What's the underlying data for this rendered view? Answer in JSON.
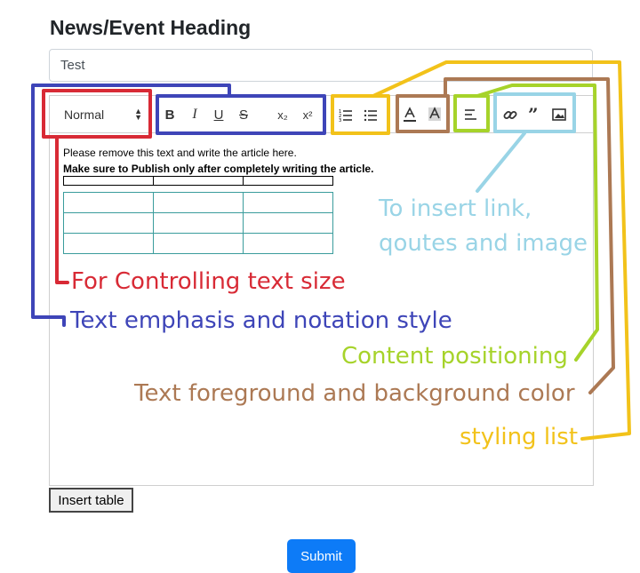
{
  "page": {
    "heading": "News/Event Heading",
    "title_value": "Test",
    "toolbar": {
      "size_select": "Normal",
      "bold": "B",
      "italic": "I",
      "underline": "U",
      "strike": "S",
      "subscript": "x₂",
      "superscript": "x²",
      "icons": [
        "ordered-list",
        "bullet-list",
        "text-color",
        "background-color",
        "align",
        "link",
        "quote",
        "image"
      ]
    },
    "editor_text": {
      "line1": "Please remove this text and write the article here.",
      "line2": "Make sure to Publish only after completely writing the article."
    },
    "insert_table_label": "Insert table",
    "submit_label": "Submit"
  },
  "annotations": {
    "text_size": "For Controlling text size",
    "emphasis": "Text emphasis and notation style",
    "link_line1": "To insert link,",
    "link_line2": "qoutes and image",
    "positioning": "Content positioning",
    "color": "Text foreground and background color",
    "list": "styling list"
  },
  "colors": {
    "red": "#d82a35",
    "blue": "#3e45b8",
    "yellow": "#f2c21a",
    "brown": "#ac7954",
    "green": "#a6d32a",
    "light_blue": "#99d4e6",
    "submit": "#0d7bf7"
  }
}
